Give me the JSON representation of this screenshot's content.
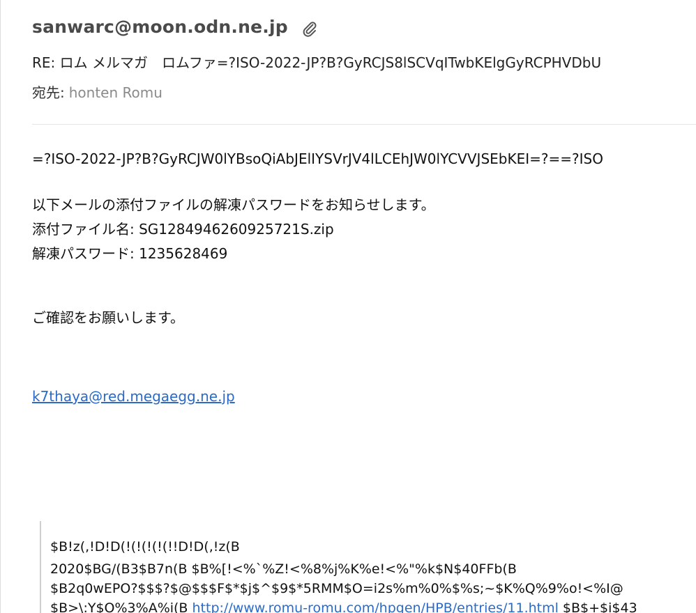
{
  "header": {
    "sender": "sanwarc@moon.odn.ne.jp",
    "attachment_icon": "paperclip-icon",
    "subject": "RE: ロム メルマガ　ロムファ=?ISO-2022-JP?B?GyRCJS8lSCVqITwbKElgGyRCPHVDbU",
    "to_label": "宛先:",
    "to_name": "honten Romu"
  },
  "body": {
    "encoded_line": "=?ISO-2022-JP?B?GyRCJW0lYBsoQiAbJElIYSVrJV4lLCEhJW0lYCVVJSEbKEI=?==?ISO",
    "line1": "以下メールの添付ファイルの解凍パスワードをお知らせします。",
    "line2": "添付ファイル名: SG1284946260925721S.zip",
    "line3": "解凍パスワード: 1235628469",
    "line4": "ご確認をお願いします。",
    "email_link": "k7thaya@red.megaegg.ne.jp"
  },
  "quote": {
    "line1": "$B!z(,!D!D(!(!(!(!(!!D!D(,!z(B",
    "line2": "2020$BG/(B3$B7n(B $B%[!<%`%Z!<%8%j%K%e!<%\"%k$N$40FFb(B",
    "line3": "$B2q0wEPO?$$$?$@$$$F$*$j$^$9$*5RMM$O=i2s%m%0%$%s;~$K%Q%9%o!<%I@",
    "line4_prefix": "$B>\\:Y$O%3%A%i(B ",
    "line4_url": "http://www.romu-romu.com/hpgen/HPB/entries/11.html",
    "line4_suffix": " $B$+$i$43"
  },
  "colors": {
    "link": "#2a6ac9",
    "sender": "#4a4a4a",
    "muted": "#8a8a8a"
  }
}
